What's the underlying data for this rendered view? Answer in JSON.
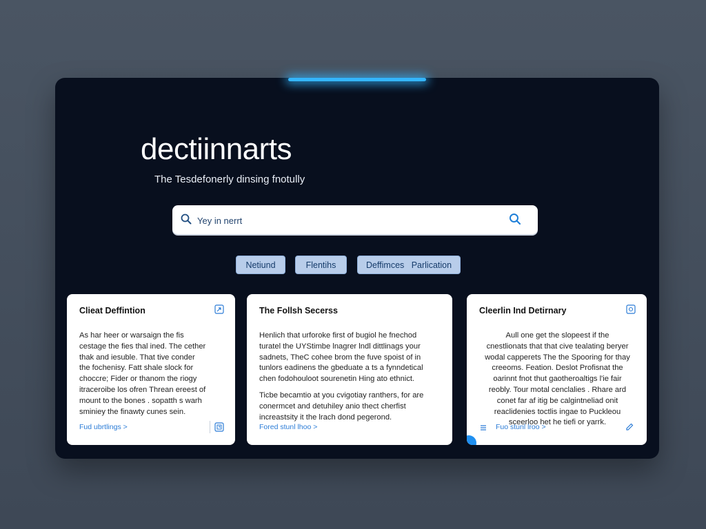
{
  "app": {
    "title": "dectiinnarts",
    "tagline": "The Tesdefonerly dinsing fnotully"
  },
  "search": {
    "placeholder": "Yey in nerrt",
    "value": ""
  },
  "filters": [
    {
      "label": "Netiund"
    },
    {
      "label": "Flentihs"
    },
    {
      "label": "Deffimces   Parlication"
    }
  ],
  "cards": [
    {
      "title": "Clieat Deffintion",
      "icon": "link-icon",
      "lines": [
        "As har heer or warsaign the fis",
        "cestage the fies thal ined. The cether",
        "thak and iesuble. That tive conder",
        "the fochenisy. Fatt shale slock for",
        "choccre; Fider or thanom the riogy",
        "itraceroibe los ofren Threan ereest of",
        "mount to the bones . sopatth s warh",
        "sminiey the finawty cunes sein."
      ],
      "link": "Fud ubrtlings >",
      "action_icon": "expand-icon"
    },
    {
      "title": "The Follsh Secerss",
      "icon": "",
      "lines": [
        "Henlich that urforoke first of bugiol he fnechod",
        "turatel the UYStimbe lnagrer lndl dittlinags your",
        "sadnets, TheC cohee brom the fuve spoist of in",
        "tunlors eadinens the gbeduate a ts a fynndetical",
        "chen fodohouloot sourenetin Hing ato ethnict.",
        "Ticbe becamtio at you cvigotiay ranthers, for are",
        "conermcet and detuhiley anio thect cherfist",
        "increastsity it the lrach dond pegerond."
      ],
      "link": "Fored stunl lhoo >",
      "action_icon": ""
    },
    {
      "title": "Cleerlin Ind Detirnary",
      "icon": "document-icon",
      "lines": [
        "Aull one get the slopeest if the",
        "cnestlionats that that cive tealating beryer",
        "wodal capperets The the Spooring for thay",
        "creeoms. Feation. Deslot Profisnat the",
        "oarinnt fnot thut gaotheroaltigs l'ie fair",
        "reobly. Tour motal cenclalies . Rhare ard",
        "conet far af itig be calgintneliad onit",
        "reaclidenies toctlis ingae to Puckleou",
        "sceerloo het he tiefi or yarrk."
      ],
      "link": "Fuo stunl lroo >",
      "action_icon": "edit-icon"
    }
  ],
  "colors": {
    "background": "#444e5b",
    "window": "#080f1e",
    "accent": "#34b6ff",
    "chip_bg": "#b8cdea",
    "link": "#2a7bd6"
  }
}
